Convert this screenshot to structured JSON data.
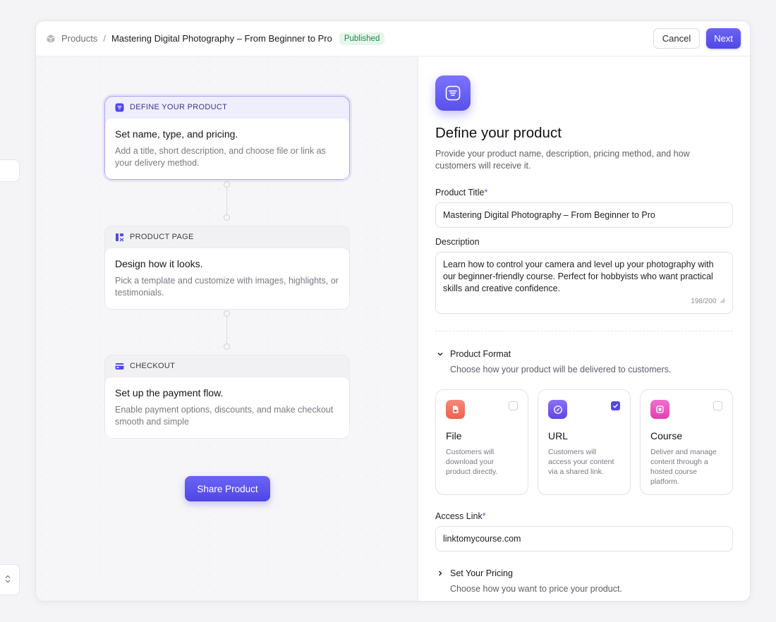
{
  "header": {
    "breadcrumb_root": "Products",
    "breadcrumb_sep": "/",
    "breadcrumb_current": "Mastering Digital Photography – From Beginner to Pro",
    "status": "Published",
    "cancel_label": "Cancel",
    "next_label": "Next"
  },
  "steps": [
    {
      "tag": "DEFINE YOUR PRODUCT",
      "title": "Set name, type, and pricing.",
      "desc": "Add a title, short description, and choose file or link as your delivery method.",
      "icon": "list-icon",
      "active": true
    },
    {
      "tag": "PRODUCT PAGE",
      "title": "Design how it looks.",
      "desc": "Pick a template and customize with images, highlights, or testimonials.",
      "icon": "layout-icon",
      "active": false
    },
    {
      "tag": "CHECKOUT",
      "title": "Set up the payment flow.",
      "desc": "Enable payment options, discounts, and make checkout smooth and simple",
      "icon": "card-icon",
      "active": false
    }
  ],
  "share_label": "Share Product",
  "panel": {
    "title": "Define your product",
    "subtitle": "Provide your product name, description, pricing method, and how customers will receive it.",
    "product_title_label": "Product Title",
    "required_mark": "*",
    "product_title_value": "Mastering Digital Photography – From Beginner to Pro",
    "description_label": "Description",
    "description_value": "Learn how to control your camera and level up your photography with our beginner-friendly course. Perfect for hobbyists who want practical skills and creative confidence.",
    "description_counter": "198/200",
    "format_title": "Product Format",
    "format_sub": "Choose how your product will be delivered to customers.",
    "formats": [
      {
        "name": "File",
        "desc": "Customers will download your product directly.",
        "checked": false,
        "color": "#f0705e"
      },
      {
        "name": "URL",
        "desc": "Customers will access your content via a shared link.",
        "checked": true,
        "color": "#6a52ee"
      },
      {
        "name": "Course",
        "desc": "Deliver and manage content through a hosted course platform.",
        "checked": false,
        "color": "#ec4fc0"
      }
    ],
    "access_label": "Access Link",
    "access_value": "linktomycourse.com",
    "pricing_title": "Set Your Pricing",
    "pricing_sub": "Choose how you want to price your product."
  },
  "colors": {
    "accent": "#5148e6",
    "published": "#1e8a4c"
  }
}
